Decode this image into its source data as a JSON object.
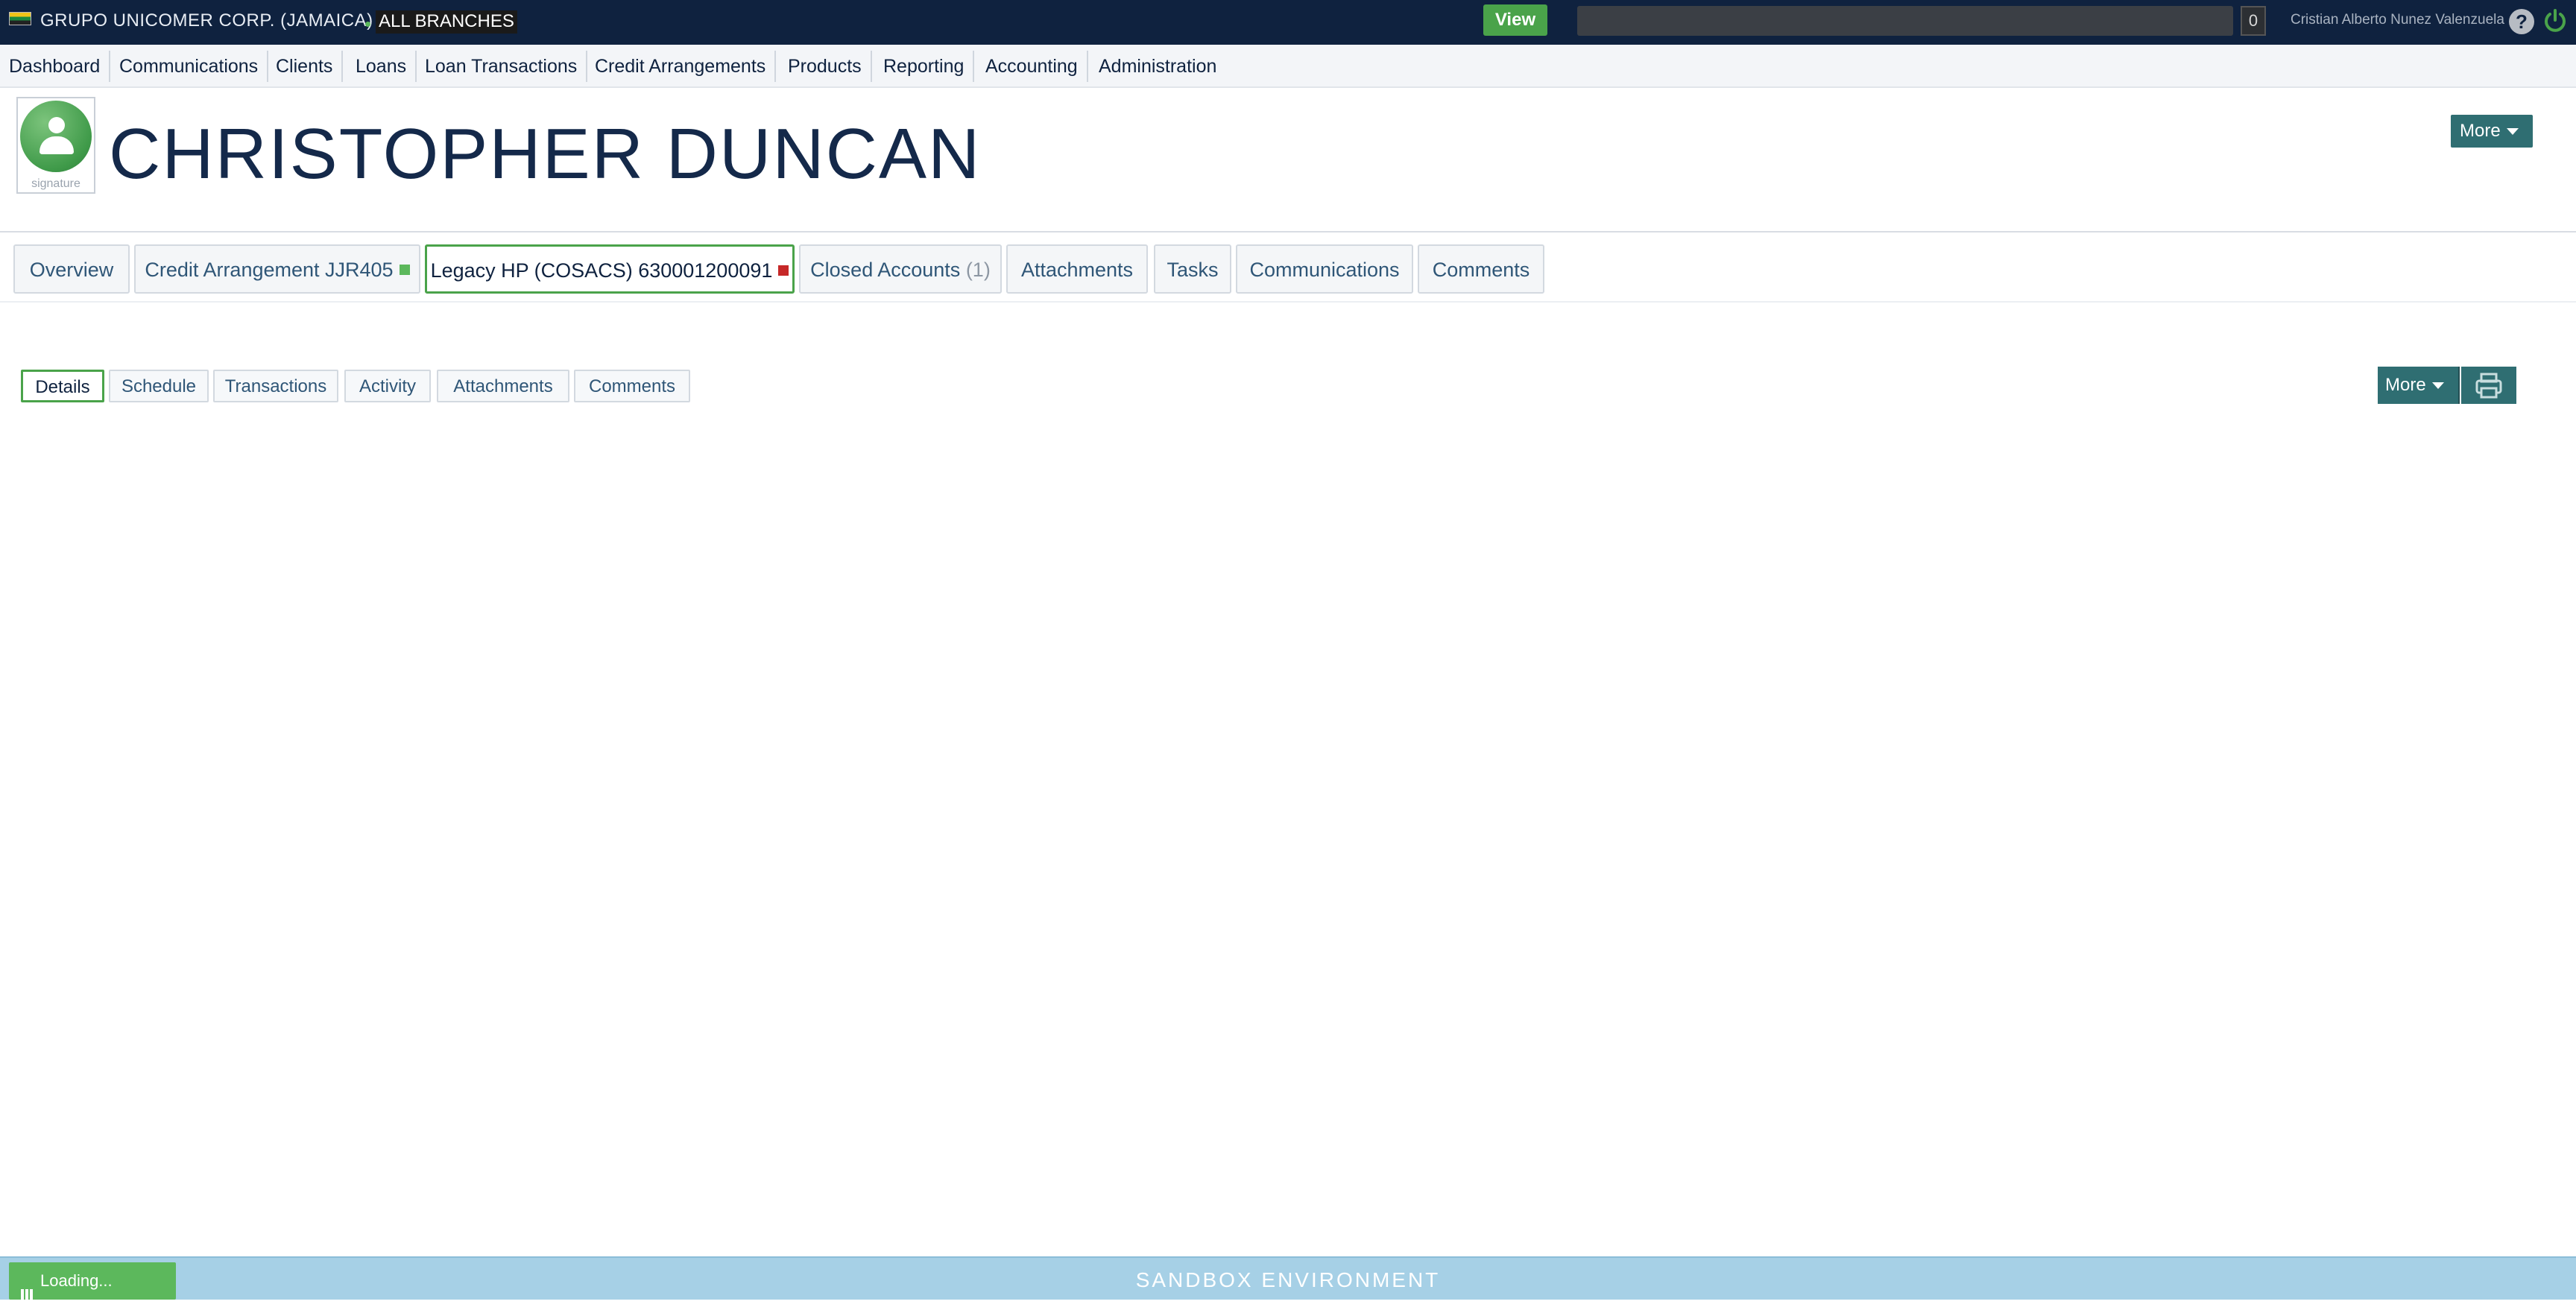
{
  "topbar": {
    "company": "GRUPO UNICOMER CORP. (JAMAICA)",
    "branch": "ALL BRANCHES",
    "view_label": "View",
    "search_value": "",
    "count": "0",
    "user": "Cristian Alberto Nunez Valenzuela",
    "help_glyph": "?",
    "icons": [
      "jamaica-flag-icon",
      "help-icon",
      "power-icon"
    ],
    "accent": "#4aa34a",
    "background": "#0f223f"
  },
  "nav": {
    "items": [
      "Dashboard",
      "Communications",
      "Clients",
      "Loans",
      "Loan Transactions",
      "Credit Arrangements",
      "Products",
      "Reporting",
      "Accounting",
      "Administration"
    ]
  },
  "client": {
    "name": "CHRISTOPHER DUNCAN",
    "signature_label": "signature",
    "more_label": "More"
  },
  "account_tabs": {
    "overview": "Overview",
    "credit_arrangement": "Credit Arrangement JJR405",
    "credit_arrangement_status_color": "#5cb85c",
    "legacy": "Legacy HP (COSACS) 630001200091",
    "legacy_status_color": "#c62828",
    "closed_accounts": "Closed Accounts",
    "closed_count": "(1)",
    "attachments": "Attachments",
    "tasks": "Tasks",
    "communications": "Communications",
    "comments": "Comments",
    "active": "legacy"
  },
  "sub_tabs": {
    "details": "Details",
    "schedule": "Schedule",
    "transactions": "Transactions",
    "activity": "Activity",
    "attachments": "Attachments",
    "comments": "Comments",
    "active": "details",
    "more_label": "More",
    "print_icon": "printer-icon"
  },
  "footer": {
    "environment": "SANDBOX ENVIRONMENT",
    "loading": "Loading...",
    "color": "#a6d0e6"
  }
}
